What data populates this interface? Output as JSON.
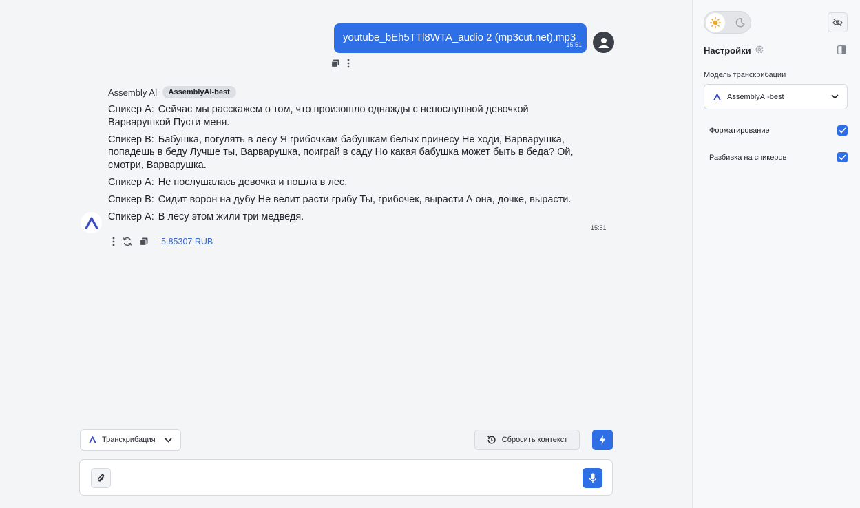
{
  "user_message": {
    "text": "youtube_bEh5TTl8WTA_audio 2 (mp3cut.net).mp3",
    "time": "15:51"
  },
  "assistant": {
    "name": "Assembly AI",
    "model_chip": "AssemblyAI-best",
    "lines": [
      {
        "speaker": "Спикер A:",
        "text": "Сейчас мы расскажем о том, что произошло однажды с непослушной девочкой Варварушкой Пусти меня."
      },
      {
        "speaker": "Спикер B:",
        "text": "Бабушка, погулять в лесу Я грибочкам бабушкам белых принесу Не ходи, Варварушка, попадешь в беду Лучше ты, Варварушка, поиграй в саду Но какая бабушка может быть в беда? Ой, смотри, Варварушка."
      },
      {
        "speaker": "Спикер A:",
        "text": "Не послушалась девочка и пошла в лес."
      },
      {
        "speaker": "Спикер B:",
        "text": "Сидит ворон на дубу Не велит расти грибу Ты, грибочек, вырасти А она, дочке, вырасти."
      },
      {
        "speaker": "Спикер A:",
        "text": "В лесу этом жили три медведя."
      }
    ],
    "time": "15:51",
    "cost": "-5.85307 RUB"
  },
  "controls": {
    "mode_label": "Транскрибация",
    "reset_label": "Сбросить контекст",
    "composer_placeholder": ""
  },
  "sidebar": {
    "title": "Настройки",
    "model_label": "Модель транскрибации",
    "model_value": "AssemblyAI-best",
    "options": [
      {
        "label": "Форматирование",
        "checked": true
      },
      {
        "label": "Разбивка на спикеров",
        "checked": true
      }
    ]
  },
  "colors": {
    "accent": "#2f6fe6",
    "logo": "#3b4cc0",
    "cost": "#3a69c9"
  }
}
